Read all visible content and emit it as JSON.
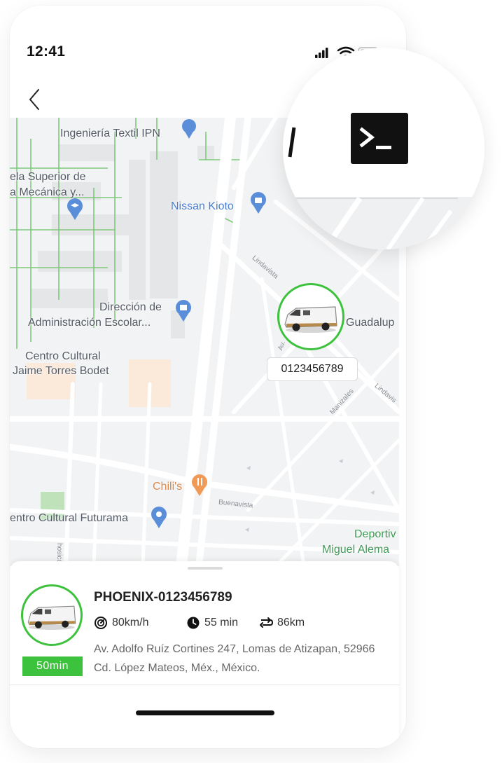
{
  "status_bar": {
    "time": "12:41"
  },
  "map": {
    "places": {
      "ingenieria_textil": "Ingeniería Textil IPN",
      "escuela_superior_1": "ela Superior de",
      "escuela_superior_2": "a Mecánica y...",
      "nissan": "Nissan Kioto",
      "direccion_1": "Dirección de",
      "direccion_2": "Administración Escolar...",
      "centro_cultural_1": "Centro Cultural",
      "centro_cultural_2": "Jaime Torres Bodet",
      "guadalupe": "Guadalup",
      "chilis": "Chili's",
      "futurama": "entro Cultural Futurama",
      "deportivo_1": "Deportiv",
      "deportivo_2": "Miguel Alema"
    },
    "streets": {
      "lindavista_1": "Lindavista",
      "lindavista_2": "Lindavis",
      "manizales": "Manizales",
      "buenavista": "Buenavista",
      "avenue": "Av.",
      "vertical": "hosica"
    },
    "vehicle_marker": {
      "plate": "0123456789"
    }
  },
  "vehicle_card": {
    "name": "PHOENIX-0123456789",
    "eta_badge": "50min",
    "speed": "80km/h",
    "duration": "55 min",
    "distance": "86km",
    "address": "Av. Adolfo Ruíz Cortines 247, Lomas de Atizapan, 52966 Cd. López Mateos, Méx., México."
  },
  "colors": {
    "accent_green": "#3cc23c",
    "map_background": "#f2f3f4",
    "park_green": "#7ec97a",
    "poi_blue": "#5b8ed8",
    "poi_orange": "#f09a55"
  },
  "icons": [
    "signal-icon",
    "wifi-icon",
    "battery-icon",
    "back-chevron-icon",
    "terminal-icon",
    "speedometer-icon",
    "clock-icon",
    "route-icon",
    "van-icon",
    "school-pin-icon",
    "shopping-pin-icon",
    "building-pin-icon",
    "restaurant-pin-icon",
    "place-pin-icon"
  ]
}
